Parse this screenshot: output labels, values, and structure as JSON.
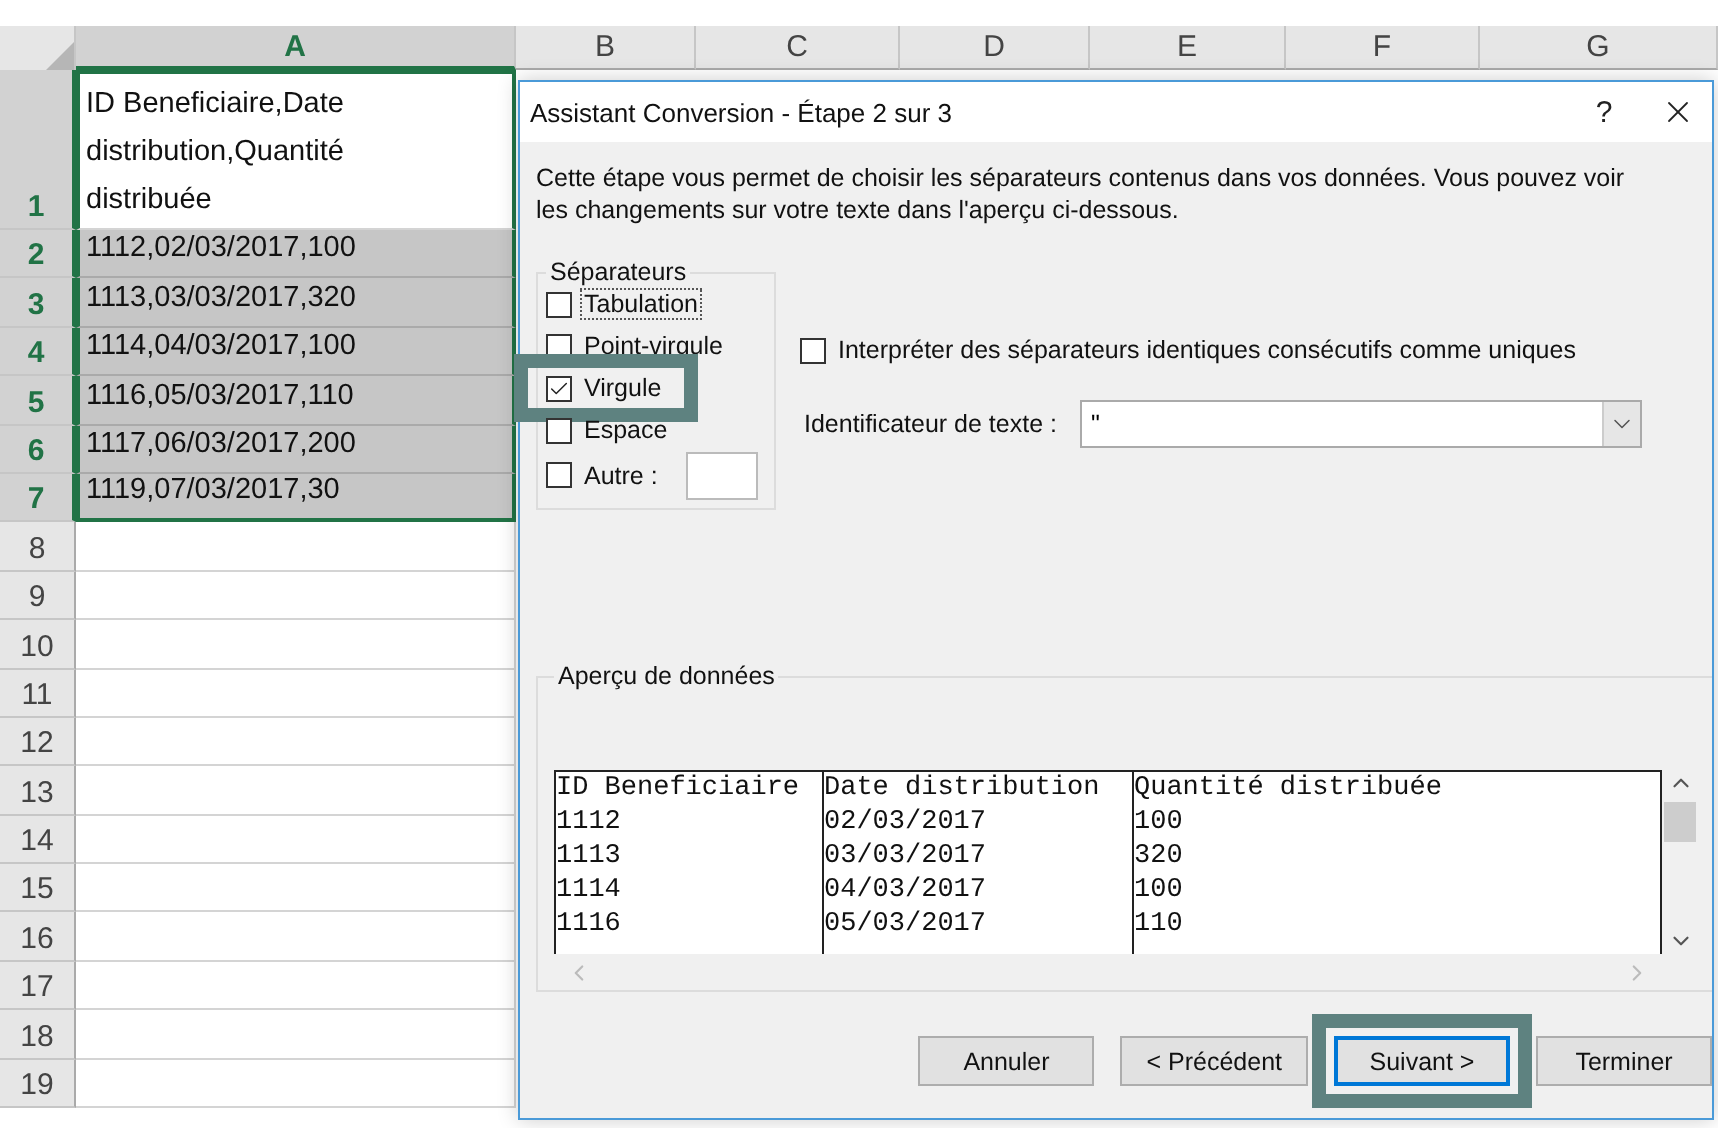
{
  "sheet": {
    "columns": [
      {
        "label": "A",
        "selected": true
      },
      {
        "label": "B",
        "selected": false
      },
      {
        "label": "C",
        "selected": false
      },
      {
        "label": "D",
        "selected": false
      },
      {
        "label": "E",
        "selected": false
      },
      {
        "label": "F",
        "selected": false
      },
      {
        "label": "G",
        "selected": false
      }
    ],
    "rows": [
      {
        "number": "1",
        "value": "ID Beneficiaire,Date distribution,Quantité distribuée",
        "selected": false,
        "in_range": true
      },
      {
        "number": "2",
        "value": "1112,02/03/2017,100",
        "selected": true,
        "in_range": true
      },
      {
        "number": "3",
        "value": "1113,03/03/2017,320",
        "selected": true,
        "in_range": true
      },
      {
        "number": "4",
        "value": "1114,04/03/2017,100",
        "selected": true,
        "in_range": true
      },
      {
        "number": "5",
        "value": "1116,05/03/2017,110",
        "selected": true,
        "in_range": true
      },
      {
        "number": "6",
        "value": "1117,06/03/2017,200",
        "selected": true,
        "in_range": true
      },
      {
        "number": "7",
        "value": "1119,07/03/2017,30",
        "selected": true,
        "in_range": true
      },
      {
        "number": "8",
        "selected": false,
        "in_range": false
      },
      {
        "number": "9",
        "selected": false,
        "in_range": false
      },
      {
        "number": "10",
        "selected": false,
        "in_range": false
      },
      {
        "number": "11",
        "selected": false,
        "in_range": false
      },
      {
        "number": "12",
        "selected": false,
        "in_range": false
      },
      {
        "number": "13",
        "selected": false,
        "in_range": false
      },
      {
        "number": "14",
        "selected": false,
        "in_range": false
      },
      {
        "number": "15",
        "selected": false,
        "in_range": false
      },
      {
        "number": "16",
        "selected": false,
        "in_range": false
      },
      {
        "number": "17",
        "selected": false,
        "in_range": false
      },
      {
        "number": "18",
        "selected": false,
        "in_range": false
      },
      {
        "number": "19",
        "selected": false,
        "in_range": false
      }
    ]
  },
  "dialog": {
    "title": "Assistant Conversion - Étape 2 sur 3",
    "help": "?",
    "description": "Cette étape vous permet de choisir les séparateurs contenus dans vos données. Vous pouvez voir les changements sur votre texte dans l'aperçu ci-dessous.",
    "separators": {
      "legend": "Séparateurs",
      "options": [
        {
          "label": "Tabulation",
          "checked": false,
          "highlighted": false,
          "focused": true
        },
        {
          "label": "Point-virgule",
          "checked": false,
          "highlighted": false,
          "focused": false
        },
        {
          "label": "Virgule",
          "checked": true,
          "highlighted": true,
          "focused": false
        },
        {
          "label": "Espace",
          "checked": false,
          "highlighted": false,
          "focused": false
        },
        {
          "label": "Autre :",
          "checked": false,
          "highlighted": false,
          "focused": false,
          "kind": "with-field"
        }
      ]
    },
    "consecutive": {
      "label": "Interpréter des séparateurs identiques consécutifs comme uniques",
      "checked": false
    },
    "qualifier": {
      "label": "Identificateur de texte :",
      "value": "\""
    },
    "preview": {
      "legend": "Aperçu de données",
      "columns": [
        {
          "header": "ID Beneficiaire",
          "values": [
            "1112",
            "1113",
            "1114",
            "1116"
          ]
        },
        {
          "header": "Date distribution",
          "values": [
            "02/03/2017",
            "03/03/2017",
            "04/03/2017",
            "05/03/2017"
          ]
        },
        {
          "header": "Quantité distribuée",
          "values": [
            "100",
            "320",
            "100",
            "110"
          ]
        }
      ]
    },
    "buttons": [
      {
        "label": "Annuler",
        "focused": false,
        "highlighted": false
      },
      {
        "label": "< Précédent",
        "focused": false,
        "highlighted": false
      },
      {
        "label": "Suivant >",
        "focused": true,
        "highlighted": true
      },
      {
        "label": "Terminer",
        "focused": false,
        "highlighted": false
      }
    ]
  }
}
